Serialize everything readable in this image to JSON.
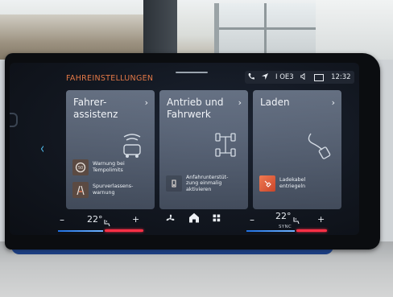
{
  "header": {
    "title": "FAHREINSTELLUNGEN",
    "status": {
      "phone_icon": "phone-settings-icon",
      "nav_icon": "navigation-arrow-icon",
      "signal_text": "I OE3",
      "volume_icon": "speaker-icon",
      "badge_icon": "screen-badge-icon",
      "time": "12:32"
    }
  },
  "cards": [
    {
      "title": "Fahrer-\nassistenz",
      "items": [
        {
          "label": "Warnung bei Tempolimits",
          "icon": "speed-limit-icon"
        },
        {
          "label": "Spurverlassens-\nwarnung",
          "icon": "lane-departure-icon"
        }
      ]
    },
    {
      "title": "Antrieb und\nFahrwerk",
      "items": [
        {
          "label": "Anfahrunterstüt-\nzung einmalig\naktivieren",
          "icon": "hill-start-icon"
        }
      ]
    },
    {
      "title": "Laden",
      "items": [
        {
          "label": "Ladekabel\nentriegeln",
          "icon": "charging-cable-icon"
        }
      ]
    }
  ],
  "climate": {
    "left_temp": "22°",
    "right_temp": "22°",
    "minus": "–",
    "plus": "+",
    "sync_label": "SYNC",
    "fan_icon": "fan-icon",
    "home_icon": "home-icon",
    "apps_icon": "apps-grid-icon",
    "seat_icon": "seat-heating-icon"
  },
  "colors": {
    "accent_orange": "#e37846",
    "blue_accent": "#4fb6e6",
    "red_indicator": "#ff3046"
  }
}
